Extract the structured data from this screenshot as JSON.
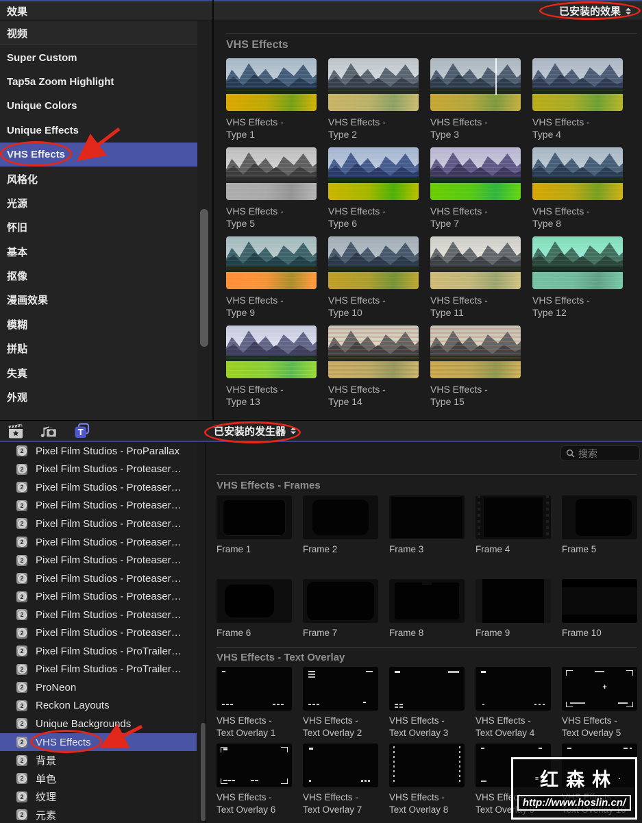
{
  "top": {
    "header": {
      "title": "效果",
      "dropdown_label": "已安装的效果"
    },
    "sidebar": {
      "items": [
        {
          "label": "视频",
          "type": "header"
        },
        {
          "label": "Super Custom"
        },
        {
          "label": "Tap5a Zoom Highlight"
        },
        {
          "label": "Unique Colors"
        },
        {
          "label": "Unique Effects"
        },
        {
          "label": "VHS Effects",
          "selected": true
        },
        {
          "label": "风格化"
        },
        {
          "label": "光源"
        },
        {
          "label": "怀旧"
        },
        {
          "label": "基本"
        },
        {
          "label": "抠像"
        },
        {
          "label": "漫画效果"
        },
        {
          "label": "模糊"
        },
        {
          "label": "拼贴"
        },
        {
          "label": "失真"
        },
        {
          "label": "外观"
        }
      ]
    },
    "grid": {
      "section_title": "VHS Effects",
      "items": [
        {
          "label": "VHS Effects - Type 1",
          "tint": "t1"
        },
        {
          "label": "VHS Effects - Type 2",
          "tint": "t2"
        },
        {
          "label": "VHS Effects - Type 3",
          "tint": "t3",
          "line": true
        },
        {
          "label": "VHS Effects - Type 4",
          "tint": "t4"
        },
        {
          "label": "VHS Effects - Type 5",
          "tint": "t5"
        },
        {
          "label": "VHS Effects - Type 6",
          "tint": "t6"
        },
        {
          "label": "VHS Effects - Type 7",
          "tint": "t7"
        },
        {
          "label": "VHS Effects - Type 8",
          "tint": "t8"
        },
        {
          "label": "VHS Effects - Type 9",
          "tint": "t9"
        },
        {
          "label": "VHS Effects - Type 10",
          "tint": "t10"
        },
        {
          "label": "VHS Effects - Type 11",
          "tint": "t11"
        },
        {
          "label": "VHS Effects - Type 12",
          "tint": "t12"
        },
        {
          "label": "VHS Effects - Type 13",
          "tint": "t13"
        },
        {
          "label": "VHS Effects - Type 14",
          "tint": "t14",
          "rscan": true
        },
        {
          "label": "VHS Effects - Type 15",
          "tint": "t15",
          "rscan": true
        }
      ]
    }
  },
  "toolbar": {
    "icons": [
      {
        "name": "effects-clapperboard-icon"
      },
      {
        "name": "photos-audio-icon"
      },
      {
        "name": "titles-generators-icon",
        "active": true
      }
    ],
    "dropdown_label": "已安装的发生器"
  },
  "bottom": {
    "search": {
      "placeholder": "搜索"
    },
    "list": {
      "items": [
        {
          "label": "Pixel Film Studios - ProParallax"
        },
        {
          "label": "Pixel Film Studios - Proteaser…"
        },
        {
          "label": "Pixel Film Studios - Proteaser…"
        },
        {
          "label": "Pixel Film Studios - Proteaser…"
        },
        {
          "label": "Pixel Film Studios - Proteaser…"
        },
        {
          "label": "Pixel Film Studios - Proteaser…"
        },
        {
          "label": "Pixel Film Studios - Proteaser…"
        },
        {
          "label": "Pixel Film Studios - Proteaser…"
        },
        {
          "label": "Pixel Film Studios - Proteaser…"
        },
        {
          "label": "Pixel Film Studios - Proteaser…"
        },
        {
          "label": "Pixel Film Studios - Proteaser…"
        },
        {
          "label": "Pixel Film Studios - ProTrailer…"
        },
        {
          "label": "Pixel Film Studios - ProTrailer…"
        },
        {
          "label": "ProNeon"
        },
        {
          "label": "Reckon Layouts"
        },
        {
          "label": "Unique Backgrounds"
        },
        {
          "label": "VHS Effects",
          "selected": true
        },
        {
          "label": "背景"
        },
        {
          "label": "单色"
        },
        {
          "label": "纹理"
        },
        {
          "label": "元素"
        }
      ]
    },
    "sections": [
      {
        "title": "VHS Effects - Frames",
        "items": [
          {
            "label": "Frame 1",
            "shape": "f1"
          },
          {
            "label": "Frame 2",
            "shape": "f2"
          },
          {
            "label": "Frame 3",
            "shape": "f3"
          },
          {
            "label": "Frame 4",
            "shape": "f4"
          },
          {
            "label": "Frame 5",
            "shape": "f5"
          },
          {
            "label": "Frame 6",
            "shape": "f6"
          },
          {
            "label": "Frame 7",
            "shape": "f7"
          },
          {
            "label": "Frame 8",
            "shape": "f8"
          },
          {
            "label": "Frame 9",
            "shape": "f9"
          },
          {
            "label": "Frame 10",
            "shape": "f10"
          }
        ]
      },
      {
        "title": "VHS Effects - Text Overlay",
        "items": [
          {
            "label": "VHS Effects - Text Overlay 1",
            "motif": "m1"
          },
          {
            "label": "VHS Effects - Text Overlay 2",
            "motif": "m2"
          },
          {
            "label": "VHS Effects - Text Overlay 3",
            "motif": "m3"
          },
          {
            "label": "VHS Effects - Text Overlay 4",
            "motif": "m4"
          },
          {
            "label": "VHS Effects - Text Overlay 5",
            "motif": "m5",
            "corners": true
          },
          {
            "label": "VHS Effects - Text Overlay 6",
            "motif": "m6",
            "corners": true
          },
          {
            "label": "VHS Effects - Text Overlay 7",
            "motif": "m7"
          },
          {
            "label": "VHS Effects - Text Overlay 8",
            "motif": "m8"
          },
          {
            "label": "VHS Effects - Text Overlay 9",
            "motif": "m9"
          },
          {
            "label": "VHS Effects - Text Overlay 10",
            "motif": "m10"
          }
        ]
      }
    ]
  },
  "watermark": {
    "title": "红森林",
    "url": "http://www.hoslin.cn/"
  },
  "colors": {
    "selection_blue": "#4a54a4",
    "annotation_red": "#e2271b",
    "window_accent": "#3f4c9b",
    "section_header_gray": "#8e8e8e"
  }
}
